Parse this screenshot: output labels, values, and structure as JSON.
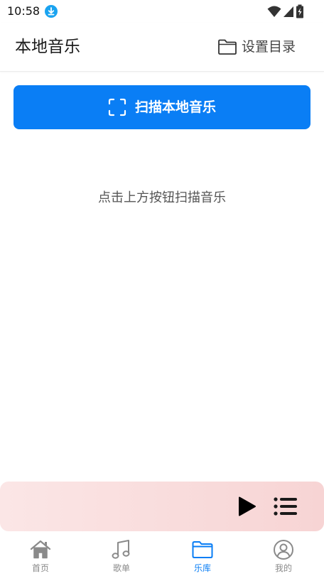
{
  "status_bar": {
    "time": "10:58"
  },
  "header": {
    "title": "本地音乐",
    "set_directory_label": "设置目录"
  },
  "scan_button": {
    "label": "扫描本地音乐"
  },
  "empty_hint": "点击上方按钮扫描音乐",
  "mini_player": {
    "play_icon": "play-icon",
    "playlist_icon": "playlist-icon"
  },
  "bottom_nav": {
    "items": [
      {
        "label": "首页",
        "icon": "home-icon"
      },
      {
        "label": "歌单",
        "icon": "music-note-icon"
      },
      {
        "label": "乐库",
        "icon": "folder-icon",
        "active": true
      },
      {
        "label": "我的",
        "icon": "user-circle-icon"
      }
    ]
  },
  "colors": {
    "accent": "#0a7ef5",
    "player_gradient_start": "#fbe6e6",
    "player_gradient_end": "#f7d4d4"
  }
}
